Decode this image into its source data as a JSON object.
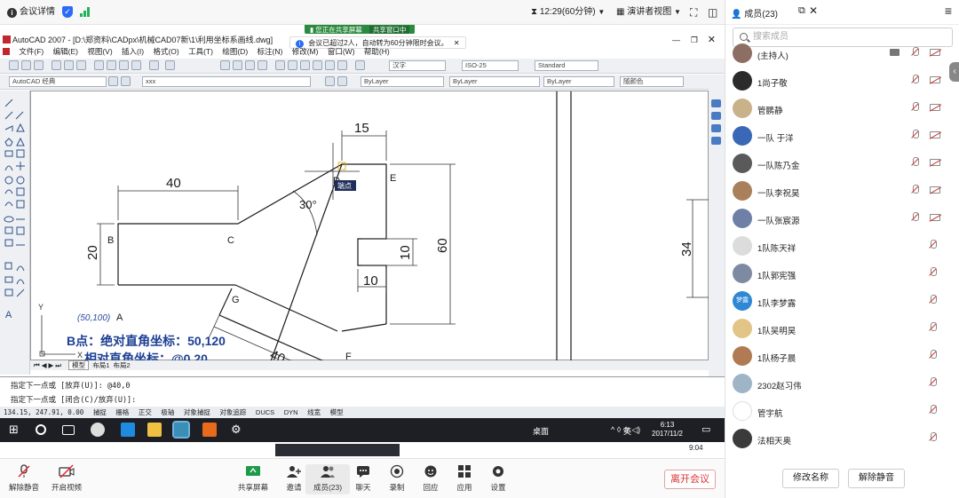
{
  "topbar": {
    "meeting_info": "会议详情",
    "timer": "12:29(60分钟)",
    "view_mode": "演讲者视图"
  },
  "panel": {
    "title": "成员(23)",
    "search_placeholder": "搜索成员",
    "members": [
      {
        "name": "(主持人)",
        "color": "#8d6e63"
      },
      {
        "name": "1尚子敬",
        "color": "#2b2b2b"
      },
      {
        "name": "管鹏静",
        "color": "#c9b18a"
      },
      {
        "name": "一队 于洋",
        "color": "#3a67b6"
      },
      {
        "name": "一队陈乃金",
        "color": "#5a5a5a"
      },
      {
        "name": "一队李祝昊",
        "color": "#a9805c"
      },
      {
        "name": "一队张宸源",
        "color": "#6f7fa6"
      },
      {
        "name": "1队陈天祥",
        "color": "#dcdcdc"
      },
      {
        "name": "1队郭宪强",
        "color": "#7d8aa1"
      },
      {
        "name": "1队李梦露",
        "color": "#2e88d6"
      },
      {
        "name": "1队吴明昊",
        "color": "#e2c487"
      },
      {
        "name": "1队杨子晨",
        "color": "#b07a53"
      },
      {
        "name": "2302赵习伟",
        "color": "#9fb4c7"
      },
      {
        "name": "管宇航",
        "color": "#ffffff"
      },
      {
        "name": "法相天奥",
        "color": "#3b3b3b"
      }
    ],
    "avatar_text_9": "梦露",
    "rename_button": "修改名称",
    "unmute_button": "解除静音"
  },
  "cad": {
    "title": "AutoCAD 2007 - [D:\\郑资料\\CADpx\\机械CAD07新\\1\\利用坐标系画线.dwg]",
    "menu": [
      "文件(F)",
      "编辑(E)",
      "视图(V)",
      "插入(I)",
      "格式(O)",
      "工具(T)",
      "绘图(D)",
      "标注(N)",
      "修改(M)",
      "窗口(W)",
      "帮助(H)"
    ],
    "workspace": "AutoCAD 经典",
    "font_combo": "汉字",
    "dim_style": "ISO-25",
    "table_style": "Standard",
    "layer_color": "ByLayer",
    "linetype": "ByLayer",
    "lineweight": "ByLayer",
    "plot_style": "随颜色",
    "layer_name": "xxx",
    "sharing_label": "您正在共享屏幕",
    "sharing_btn": "共享窗口中",
    "notice": "会议已超过2人，自动转为60分钟限时会议。",
    "tabs": [
      "模型",
      "布局1",
      "布局2"
    ],
    "cmd_line1": "指定下一点或 [放弃(U)]: @40,0",
    "cmd_line2": "指定下一点或 [闭合(C)/放弃(U)]:",
    "coords": "134.15, 247.91, 0.00",
    "status_items": [
      "捕捉",
      "栅格",
      "正交",
      "极轴",
      "对象捕捉",
      "对象追踪",
      "DUCS",
      "DYN",
      "线宽",
      "模型"
    ],
    "drawing": {
      "dims": {
        "d40": "40",
        "d15": "15",
        "d20": "20",
        "d60": "60",
        "d10a": "10",
        "d10b": "10",
        "d30": "30°",
        "d34": "34",
        "d40b": "40"
      },
      "labels": {
        "A": "A",
        "B": "B",
        "C": "C",
        "D": "D",
        "E": "E",
        "F": "F",
        "G": "G",
        "coordA": "(50,100)"
      },
      "tooltip": "端点",
      "note1": "B点：绝对直角坐标：50,120",
      "note2": "相对直角坐标：@0,20"
    }
  },
  "taskbar": {
    "desktop": "桌面",
    "ime": "英",
    "time": "6:13",
    "date": "2017/11/2",
    "time2": "9:04"
  },
  "bottom": {
    "items": [
      "解除静音",
      "开启视频",
      "共享屏幕",
      "邀请",
      "成员(23)",
      "聊天",
      "录制",
      "回应",
      "应用",
      "设置"
    ],
    "leave": "离开会议"
  }
}
